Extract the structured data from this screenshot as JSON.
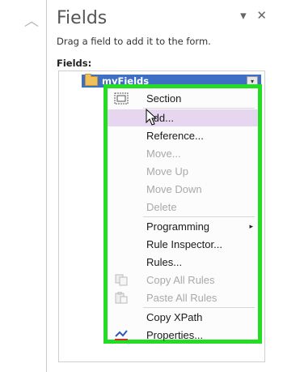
{
  "pane": {
    "title": "Fields",
    "hint": "Drag a field to add it to the form.",
    "fields_label": "Fields:",
    "controls": {
      "dropdown": "▾",
      "close": "✕"
    }
  },
  "gutter": {
    "chevron": "︿"
  },
  "tree": {
    "node_label": "myFields",
    "node_dropdown": "▾"
  },
  "menu": {
    "items": [
      {
        "label": "Section",
        "enabled": true
      },
      {
        "label": "Add...",
        "enabled": true,
        "highlighted": true
      },
      {
        "label": "Reference...",
        "enabled": true
      },
      {
        "label": "Move...",
        "enabled": false
      },
      {
        "label": "Move Up",
        "enabled": false
      },
      {
        "label": "Move Down",
        "enabled": false
      },
      {
        "label": "Delete",
        "enabled": false
      },
      {
        "label": "Programming",
        "enabled": true,
        "submenu": "▸"
      },
      {
        "label": "Rule Inspector...",
        "enabled": true
      },
      {
        "label": "Rules...",
        "enabled": true
      },
      {
        "label": "Copy All Rules",
        "enabled": false
      },
      {
        "label": "Paste All Rules",
        "enabled": false
      },
      {
        "label": "Copy XPath",
        "enabled": true
      },
      {
        "label": "Properties...",
        "enabled": true
      }
    ]
  },
  "colors": {
    "highlight_border": "#22dd22",
    "selected_node": "#3d6fc4",
    "hover_item": "#e6d6ef"
  }
}
